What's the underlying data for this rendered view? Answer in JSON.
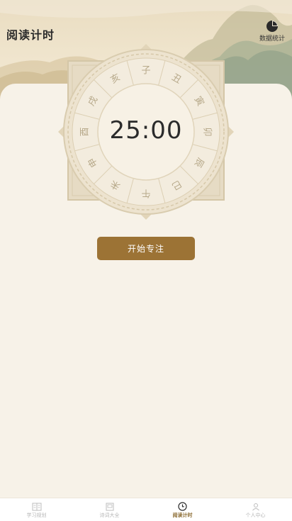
{
  "header": {
    "title": "阅读计时",
    "stats_label": "数据统计"
  },
  "timer": {
    "time": "25:00",
    "branches": [
      "子",
      "丑",
      "寅",
      "卯",
      "辰",
      "巳",
      "午",
      "未",
      "申",
      "酉",
      "戌",
      "亥"
    ]
  },
  "actions": {
    "start_label": "开始专注"
  },
  "tabbar": {
    "items": [
      {
        "label": "学习规划",
        "icon": "book-icon",
        "active": false
      },
      {
        "label": "诗词大全",
        "icon": "notebook-icon",
        "active": false
      },
      {
        "label": "阅读计时",
        "icon": "clock-icon",
        "active": true
      },
      {
        "label": "个人中心",
        "icon": "person-icon",
        "active": false
      }
    ]
  },
  "colors": {
    "accent": "#9c7335",
    "background": "#f6f1e6",
    "dial": "#e8dcc5"
  }
}
